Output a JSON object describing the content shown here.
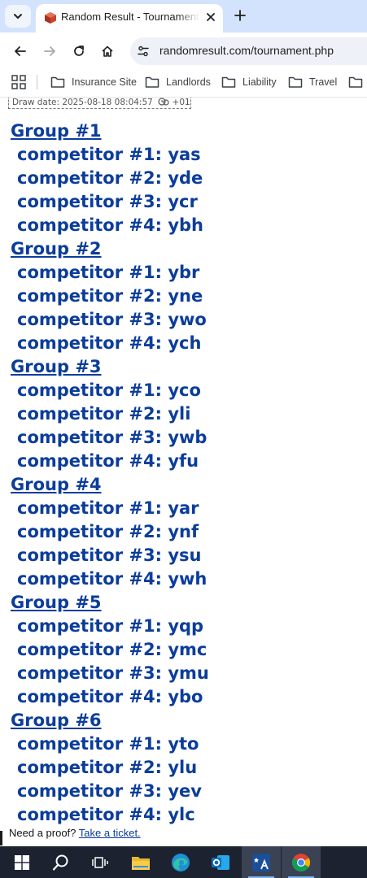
{
  "browser": {
    "tab": {
      "title": "Random Result - Tournament draw",
      "icon": "cube-favicon-icon"
    },
    "address": {
      "url": "randomresult.com/tournament.php"
    },
    "bookmarks": [
      {
        "label": "Insurance Site"
      },
      {
        "label": "Landlords"
      },
      {
        "label": "Liability"
      },
      {
        "label": "Travel"
      }
    ]
  },
  "page": {
    "draw_date": "Draw date: 2025-08-18 08:04:57",
    "timezone": "+01",
    "groups": [
      {
        "title": "Group #1",
        "competitors": [
          "competitor #1: yas",
          "competitor #2: yde",
          "competitor #3: ycr",
          "competitor #4: ybh"
        ]
      },
      {
        "title": "Group #2",
        "competitors": [
          "competitor #1: ybr",
          "competitor #2: yne",
          "competitor #3: ywo",
          "competitor #4: ych"
        ]
      },
      {
        "title": "Group #3",
        "competitors": [
          "competitor #1: yco",
          "competitor #2: yli",
          "competitor #3: ywb",
          "competitor #4: yfu"
        ]
      },
      {
        "title": "Group #4",
        "competitors": [
          "competitor #1: yar",
          "competitor #2: ynf",
          "competitor #3: ysu",
          "competitor #4: ywh"
        ]
      },
      {
        "title": "Group #5",
        "competitors": [
          "competitor #1: yqp",
          "competitor #2: ymc",
          "competitor #3: ymu",
          "competitor #4: ybo"
        ]
      },
      {
        "title": "Group #6",
        "competitors": [
          "competitor #1: yto",
          "competitor #2: ylu",
          "competitor #3: yev",
          "competitor #4: ylc"
        ]
      }
    ],
    "proof_text": "Need a proof?",
    "proof_link": "Take a ticket."
  },
  "colors": {
    "link": "#0b3d9a",
    "tabstrip": "#d3e3fd",
    "taskbar": "#1c2230"
  }
}
